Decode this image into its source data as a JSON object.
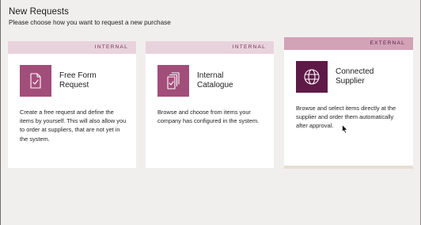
{
  "page": {
    "title": "New Requests",
    "subtitle": "Please choose how you want to request a new purchase"
  },
  "cards": [
    {
      "tag": "INTERNAL",
      "title": "Free Form Request",
      "description": "Create a free request and define the items by yourself. This will also allow you to order at suppliers, that are not yet in the system.",
      "icon": "free-form-request-icon",
      "color": "#a24e7a"
    },
    {
      "tag": "INTERNAL",
      "title": "Internal Catalogue",
      "description": "Browse and choose from items your company has configured in the system.",
      "icon": "catalogue-icon",
      "color": "#a24e7a"
    },
    {
      "tag": "EXTERNAL",
      "title": "Connected Supplier",
      "description": "Browse and select items directly at the supplier and order them automatically after approval.",
      "icon": "globe-icon",
      "color": "#5e1a47"
    }
  ],
  "colors": {
    "background": "#f1efee",
    "internal_tag_bg": "#e8d3dc",
    "external_tag_bg": "#d2a2b7",
    "accent": "#a24e7a",
    "accent_dark": "#5e1a47"
  }
}
